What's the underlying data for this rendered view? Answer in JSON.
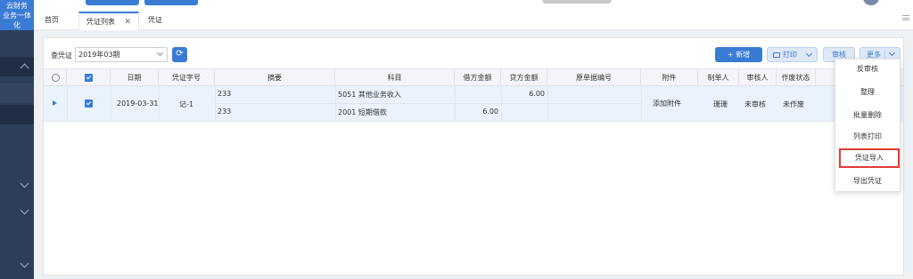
{
  "app": {
    "brand_line1": "云财务",
    "brand_line2": "业务一体化"
  },
  "tabs": [
    {
      "label": "首页"
    },
    {
      "label": "凭证列表",
      "close": "✕"
    },
    {
      "label": "凭证"
    }
  ],
  "toolbar": {
    "query_label": "查凭证",
    "period_value": "2019年03期",
    "refresh_icon": "⟳",
    "new_label": "+ 新增",
    "print_label": "打印",
    "audit_label": "审核",
    "more_label": "更多"
  },
  "table": {
    "columns": [
      "日期",
      "凭证字号",
      "摘要",
      "科目",
      "借方金额",
      "贷方金额",
      "原单据编号",
      "附件",
      "制单人",
      "审核人",
      "作废状态"
    ],
    "rows": [
      {
        "date": "2019-03-31",
        "voucher_no": "记-1",
        "lines": [
          {
            "summary": "233",
            "account": "5051 其他业务收入",
            "debit": "",
            "credit": "6.00"
          },
          {
            "summary": "233",
            "account": "2001 短期借款",
            "debit": "6.00",
            "credit": ""
          }
        ],
        "attachment": "添加附件",
        "maker": "珊珊",
        "auditor": "未审核",
        "void_status": "未作废"
      }
    ]
  },
  "more_menu": {
    "items": [
      "反审核",
      "整理",
      "批量删除",
      "列表打印",
      "凭证导入",
      "导出凭证"
    ],
    "highlighted_index": 4
  },
  "colors": {
    "accent": "#3a7bd5",
    "sidebar": "#2c3e5a",
    "highlight_border": "#e53935",
    "row_selected": "#e9f2fd"
  }
}
